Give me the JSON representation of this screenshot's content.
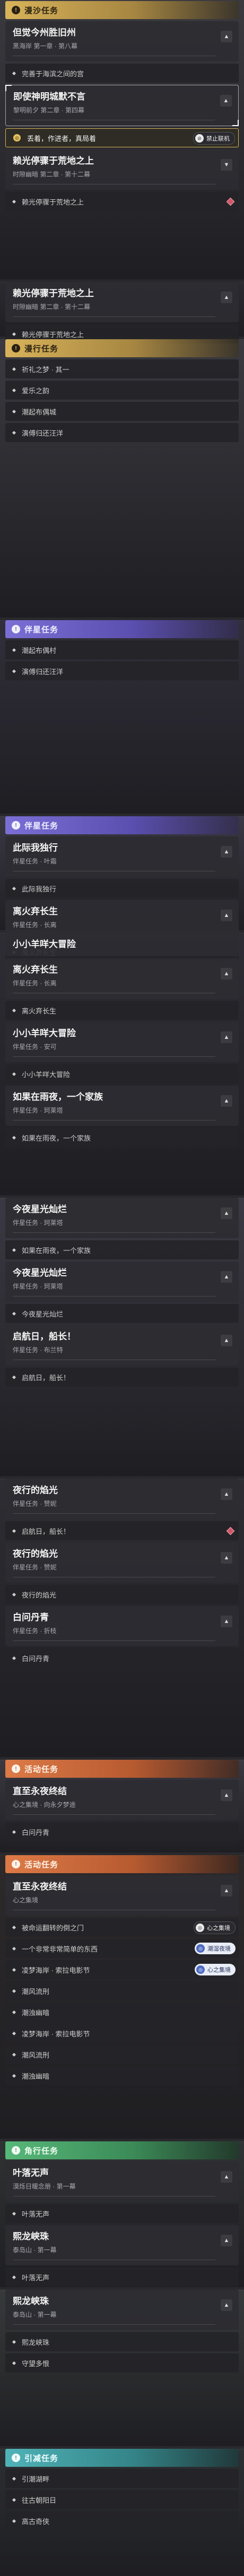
{
  "icons": {
    "quest": "!",
    "lock": "⊘",
    "chevron_up": "▲",
    "chevron_down": "▼",
    "target": "◎"
  },
  "colors": {
    "gold": "#d8b35a",
    "purple": "#7b6fd6",
    "orange": "#dd7a47",
    "green": "#57b879",
    "teal": "#4fb3b8",
    "red_badge": "#d2566a"
  },
  "panels": [
    {
      "category": {
        "label": "漫沙任务",
        "color": "yellow"
      },
      "cards": [
        {
          "title": "但觉今州胜旧州",
          "sub": "黑海岸 第一章 · 第八幕",
          "chev": "up",
          "objectives": [
            {
              "text": "完善于海滨之间的宫"
            }
          ]
        },
        {
          "title": "即使神明城默不言",
          "sub": "黎明前夕 第二章 · 第四幕",
          "chev": "up",
          "selected": true,
          "objectives": [
            {
              "text": "丢着，作进者，真局着",
              "active": true,
              "chip": {
                "style": "dark",
                "icon": "⊘",
                "label": "禁止联机"
              }
            }
          ]
        },
        {
          "title": "赖光停骤于荒地之上",
          "sub": "时隙幽暗 第二章 · 第十二幕",
          "chev": "down",
          "objectives": [
            {
              "text": "赖光停骤于荒地之上",
              "badge": true
            }
          ]
        }
      ]
    },
    {
      "cards": [
        {
          "title": "赖光停骤于荒地之上",
          "sub": "时隙幽暗 第二章 · 第十二幕",
          "chev": "up",
          "objectives": [
            {
              "text": "赖光停骤于荒地之上"
            }
          ]
        }
      ]
    },
    {
      "category": {
        "label": "漫行任务",
        "color": "yellow"
      },
      "cards": [],
      "objectives": [
        {
          "text": "祈礼之梦 · 其一"
        },
        {
          "text": "爱乐之韵"
        },
        {
          "text": "潮起布偶城"
        },
        {
          "text": "演傅归还汪洋"
        }
      ]
    },
    {
      "category": {
        "label": "伴星任务",
        "color": "purple"
      },
      "cards": [],
      "objectives": [
        {
          "text": "潮起布偶村"
        },
        {
          "text": "演傅归还汪洋"
        }
      ]
    },
    {
      "category": {
        "label": "伴星任务",
        "color": "purple"
      },
      "cards": [
        {
          "title": "此际我独行",
          "sub": "伴星任务 · 叶霜",
          "chev": "up",
          "objectives": [
            {
              "text": "此际我独行"
            }
          ]
        },
        {
          "title": "离火弃长生",
          "sub": "伴星任务 · 长离",
          "chev": "up",
          "objectives": [
            {
              "text": "离火弃长生"
            }
          ]
        }
      ]
    },
    {
      "cards": [
        {
          "title": "小小羊咩大冒险",
          "sub": "",
          "chev": "none",
          "objectives": []
        },
        {
          "title": "离火弃长生",
          "sub": "伴星任务 · 长离",
          "chev": "up",
          "objectives": [
            {
              "text": "离火弃长生"
            }
          ]
        },
        {
          "title": "小小羊咩大冒险",
          "sub": "伴星任务 · 安可",
          "chev": "up",
          "objectives": [
            {
              "text": "小小羊咩大冒险"
            }
          ]
        },
        {
          "title": "如果在雨夜，一个家族",
          "sub": "伴星任务 · 珂莱塔",
          "chev": "up",
          "objectives": [
            {
              "text": "如果在雨夜，一个家族"
            }
          ]
        }
      ]
    },
    {
      "cards": [
        {
          "title": "今夜星光灿烂",
          "sub": "伴星任务 · 珂莱塔",
          "chev": "up",
          "objectives": [
            {
              "text": "如果在雨夜，一个家族"
            }
          ]
        },
        {
          "title": "今夜星光灿烂",
          "sub": "伴星任务 · 珂莱塔",
          "chev": "up",
          "objectives": [
            {
              "text": "今夜星光灿烂"
            }
          ]
        },
        {
          "title": "启航日，船长！",
          "sub": "伴星任务 · 布兰特",
          "chev": "up",
          "objectives": [
            {
              "text": "启航日，船长！"
            }
          ]
        }
      ]
    },
    {
      "cards": [
        {
          "title": "夜行的焰光",
          "sub": "伴星任务 · 赞妮",
          "chev": "up",
          "objectives": [
            {
              "text": "启航日，船长！",
              "badge": true
            }
          ]
        },
        {
          "title": "夜行的焰光",
          "sub": "伴星任务 · 赞妮",
          "chev": "up",
          "objectives": [
            {
              "text": "夜行的焰光"
            }
          ]
        },
        {
          "title": "白问丹青",
          "sub": "伴星任务 · 折枝",
          "chev": "up",
          "objectives": [
            {
              "text": "白问丹青"
            }
          ]
        }
      ]
    },
    {
      "category": {
        "label": "活动任务",
        "color": "orange"
      },
      "cards": [
        {
          "title": "直至永夜终结",
          "sub": "心之集境 · 向永夕梦途",
          "chev": "up",
          "objectives": [
            {
              "text": "白问丹青"
            }
          ]
        }
      ]
    },
    {
      "category": {
        "label": "活动任务",
        "color": "orange"
      },
      "cards": [
        {
          "title": "直至永夜终结",
          "sub": "心之集境",
          "chev": "up",
          "objectives": [
            {
              "text": "被命运翻转的倒之门",
              "chip": {
                "style": "dark",
                "icon": "◎",
                "label": "心之集境"
              }
            },
            {
              "text": "一个非常非常简单的东西",
              "chip": {
                "style": "light",
                "icon": "◎",
                "label": "潮湿夜境"
              }
            },
            {
              "text": "凌梦海岸 · 索拉电影节",
              "chip": {
                "style": "light",
                "icon": "◎",
                "label": "心之集境"
              }
            },
            {
              "text": "潮风流刑"
            },
            {
              "text": "潮浊幽暗"
            },
            {
              "text": "凌梦海岸 · 索拉电影节"
            },
            {
              "text": "潮风流刑"
            },
            {
              "text": "潮浊幽暗"
            }
          ]
        }
      ]
    },
    {
      "category": {
        "label": "角行任务",
        "color": "green"
      },
      "cards": [
        {
          "title": "叶落无声",
          "sub": "漠烁日暖念册 · 第一幕",
          "chev": "up",
          "objectives": [
            {
              "text": "叶落无声"
            }
          ]
        },
        {
          "title": "熙龙峡珠",
          "sub": "泰岛山 · 第一幕",
          "chev": "up",
          "objectives": [
            {
              "text": "叶落无声"
            }
          ]
        }
      ]
    },
    {
      "cards": [
        {
          "title": "熙龙峡珠",
          "sub": "泰岛山 · 第一幕",
          "chev": "up",
          "objectives": [
            {
              "text": "熙龙峡珠"
            },
            {
              "text": "守望多恨"
            }
          ]
        }
      ]
    },
    {
      "category": {
        "label": "引减任务",
        "color": "teal"
      },
      "cards": [],
      "objectives": [
        {
          "text": "引潮湖畔"
        },
        {
          "text": "往古朝阳日"
        },
        {
          "text": "高古奇侠"
        }
      ]
    }
  ]
}
